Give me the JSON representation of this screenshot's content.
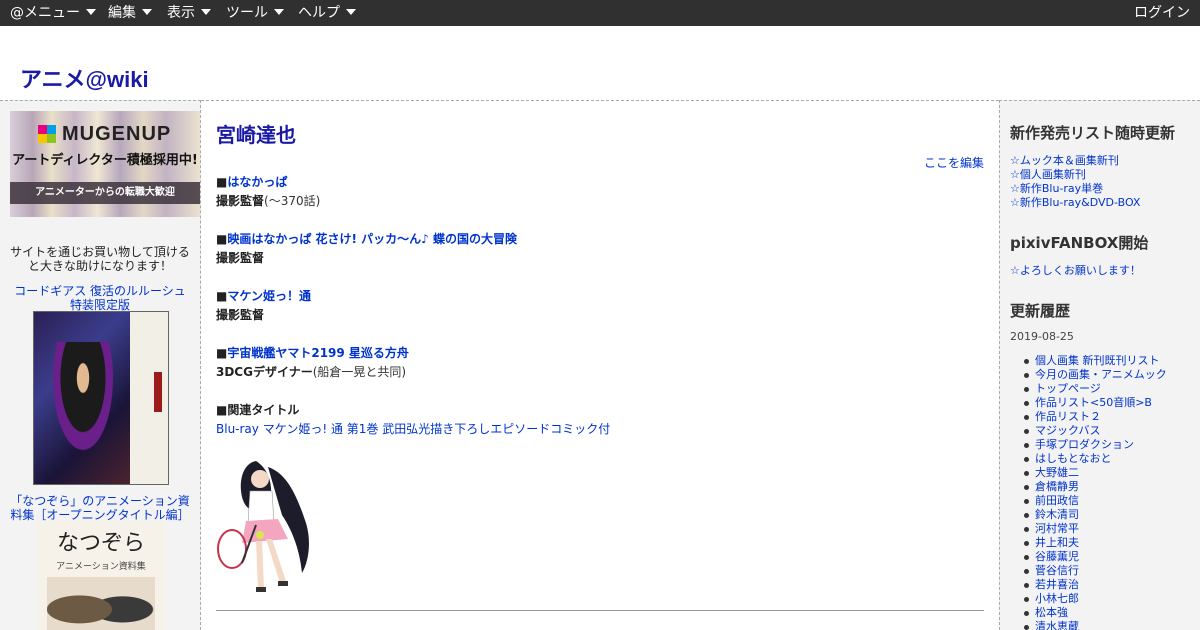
{
  "menubar": {
    "items": [
      "@メニュー",
      "編集",
      "表示",
      "ツール",
      "ヘルプ"
    ],
    "login": "ログイン"
  },
  "site": {
    "title": "アニメ@wiki"
  },
  "left": {
    "banner": {
      "logo": "MUGENUP",
      "line1": "アートディレクター積極採用中!",
      "line2": "アニメーターからの転職大歓迎"
    },
    "promo_text": "サイトを通じお買い物して頂けると大きな助けになります！",
    "product1": "コードギアス 復活のルルーシュ 特装限定版",
    "product2": "「なつぞら」のアニメーション資料集［オープニングタイトル編］",
    "cover2_title": "なつぞら",
    "cover2_sub": "アニメーション資料集"
  },
  "main": {
    "title": "宮崎達也",
    "edit": "ここを編集",
    "entries": [
      {
        "marker": "■",
        "title": "はなかっぱ",
        "role": "撮影監督",
        "note": "(～370話)"
      },
      {
        "marker": "■",
        "title": "映画はなかっぱ 花さけ! パッカ～ん♪ 蝶の国の大冒険",
        "role": "撮影監督",
        "note": ""
      },
      {
        "marker": "■",
        "title": "マケン姫っ！通",
        "role": "撮影監督",
        "note": ""
      },
      {
        "marker": "■",
        "title": "宇宙戦艦ヤマト2199 星巡る方舟",
        "role": "3DCGデザイナー",
        "note": "(船倉一晃と共同)"
      }
    ],
    "related_title": "■関連タイトル",
    "related_link": "Blu-ray マケン姫っ! 通 第1巻 武田弘光描き下ろしエピソードコミック付"
  },
  "right": {
    "new_release": {
      "heading": "新作発売リスト随時更新",
      "links": [
        "☆ムック本＆画集新刊",
        "☆個人画集新刊",
        "☆新作Blu-ray単巻",
        "☆新作Blu-ray&DVD-BOX"
      ]
    },
    "fanbox": {
      "heading": "pixivFANBOX開始",
      "link": "☆よろしくお願いします！"
    },
    "history": {
      "heading": "更新履歴",
      "date": "2019-08-25",
      "items": [
        "個人画集 新刊既刊リスト",
        "今月の画集・アニメムック",
        "トップページ",
        "作品リスト<50音順>B",
        "作品リスト２",
        "マジックバス",
        "手塚プロダクション",
        "はしもとなおと",
        "大野雄二",
        "倉橋静男",
        "前田政信",
        "鈴木清司",
        "河村常平",
        "井上和夫",
        "谷藤薫児",
        "菅谷信行",
        "若井喜治",
        "小林七郎",
        "松本強",
        "清水恵蔵"
      ]
    }
  },
  "colors": {
    "menubar_bg": "#303030",
    "link": "#0033cc",
    "title": "#1a1aa6",
    "sidebar_bg": "#f3f3f3"
  }
}
